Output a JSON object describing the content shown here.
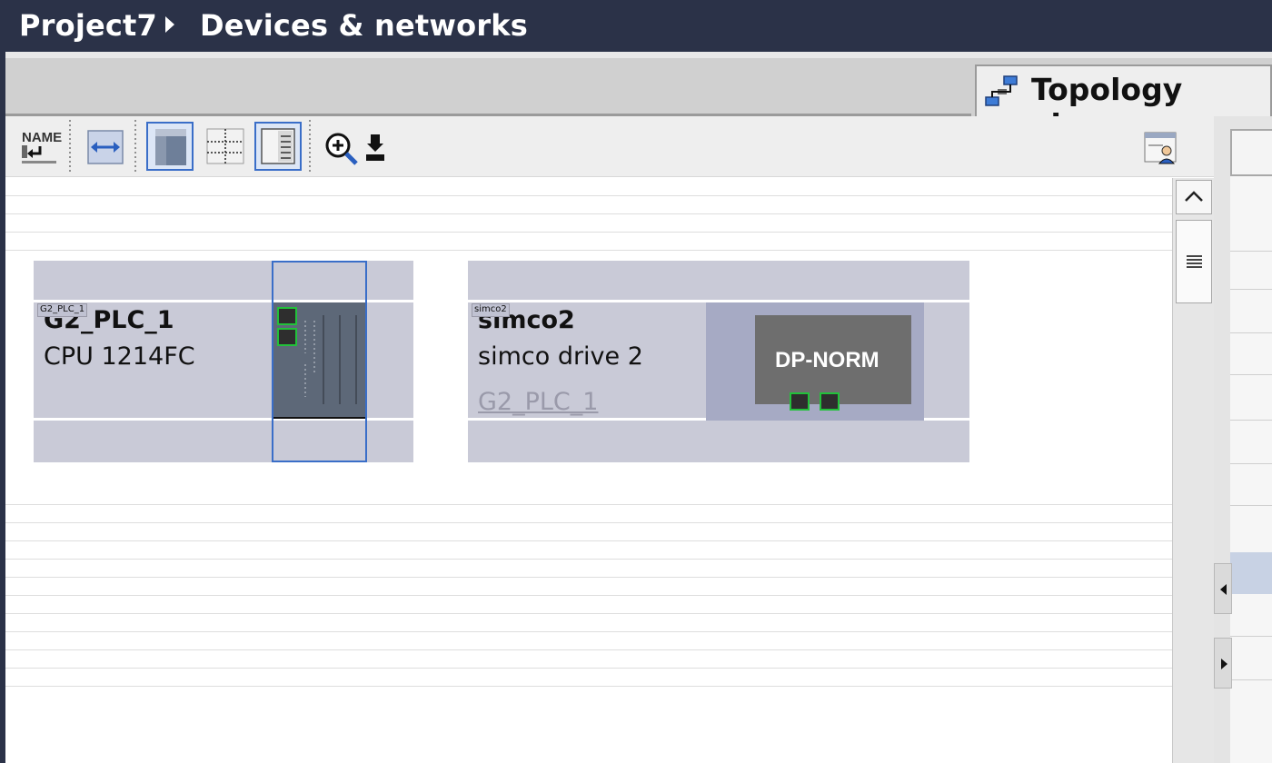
{
  "breadcrumb": {
    "project": "Project7",
    "page": "Devices & networks"
  },
  "view_tab": {
    "label": "Topology view",
    "icon": "topology-icon"
  },
  "toolbar": {
    "buttons": [
      {
        "name": "NAME",
        "icon": "show-device-name-icon"
      },
      {
        "name": "",
        "icon": "fit-width-icon"
      },
      {
        "name": "",
        "icon": "page-break-icon"
      },
      {
        "name": "",
        "icon": "grid-icon"
      },
      {
        "name": "",
        "icon": "overview-panel-icon"
      },
      {
        "name": "",
        "icon": "zoom-icon"
      },
      {
        "name": "",
        "icon": "download-icon"
      },
      {
        "name": "",
        "icon": "user-panel-icon"
      }
    ]
  },
  "devices": [
    {
      "tag": "G2_PLC_1",
      "name": "G2_PLC_1",
      "type": "CPU 1214FC"
    },
    {
      "tag": "simco2",
      "name": "simco2",
      "type": "simco drive 2",
      "assigned_controller": "G2_PLC_1",
      "module_label": "DP-NORM"
    }
  ],
  "colors": {
    "header_bg": "#2b3248",
    "device_bg": "#c9cad7",
    "port_border": "#22c03a",
    "selection": "#3a6ec8"
  }
}
